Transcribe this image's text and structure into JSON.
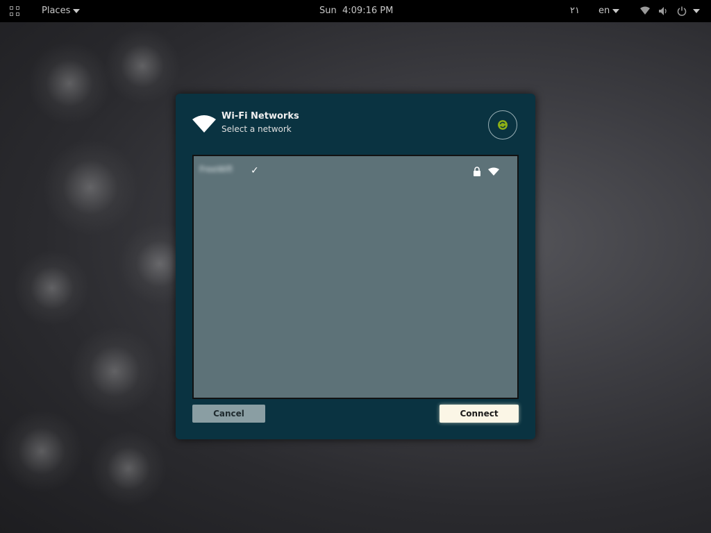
{
  "topbar": {
    "activities_icon": "app-grid-icon",
    "places_label": "Places",
    "clock": "Sun  4:09:16 PM",
    "indicator_text": "٢١",
    "keyboard_label": "en",
    "icons": [
      "network-icon",
      "volume-icon",
      "power-icon"
    ]
  },
  "dialog": {
    "icon": "wifi-icon",
    "title": "Wi-Fi Networks",
    "subtitle": "Select a network",
    "refresh_icon": "refresh-icon",
    "networks": [
      {
        "name": "FreeWifi",
        "connected_icon": "checkmark-icon",
        "secured_icon": "lock-icon",
        "signal_icon": "wifi-signal-icon"
      }
    ],
    "cancel_label": "Cancel",
    "connect_label": "Connect"
  },
  "colors": {
    "dialog_bg": "#0a3341",
    "list_bg": "#5d7278",
    "accent": "#8db016"
  }
}
